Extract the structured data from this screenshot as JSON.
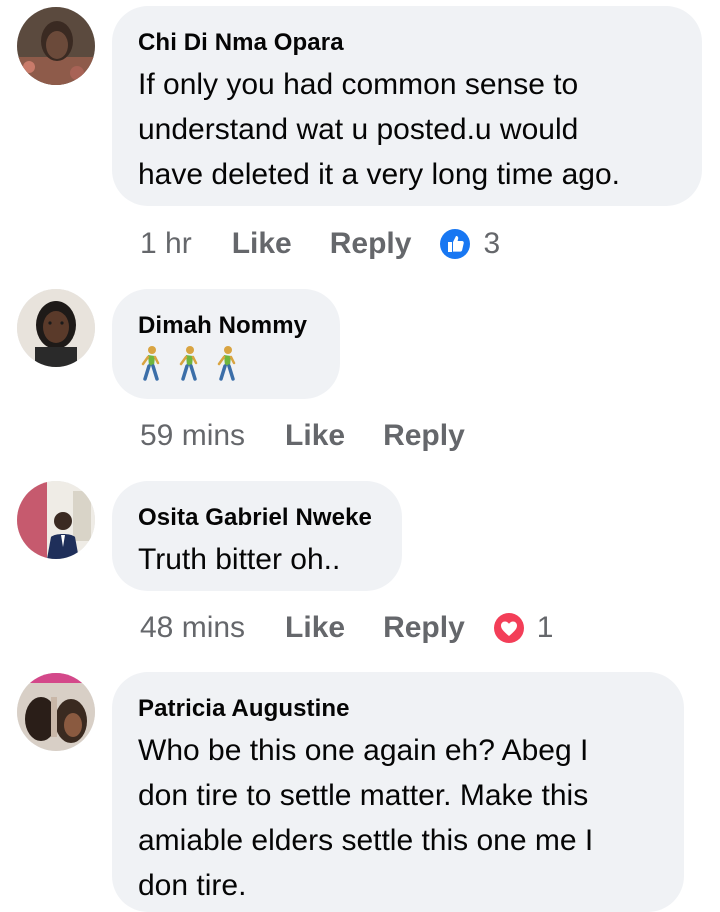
{
  "comments": [
    {
      "author": "Chi Di Nma Opara",
      "lines": [
        "If only you had common sense to",
        "understand wat u posted.u would",
        "have deleted it a very long time ago."
      ],
      "time": "1 hr",
      "like_label": "Like",
      "reply_label": "Reply",
      "reaction": "like",
      "reaction_count": "3"
    },
    {
      "author": "Dimah Nommy",
      "emoji": [
        "🚶",
        "🚶",
        "🚶"
      ],
      "time": "59 mins",
      "like_label": "Like",
      "reply_label": "Reply"
    },
    {
      "author": "Osita Gabriel Nweke",
      "lines": [
        "Truth bitter oh.."
      ],
      "time": "48 mins",
      "like_label": "Like",
      "reply_label": "Reply",
      "reaction": "love",
      "reaction_count": "1"
    },
    {
      "author": "Patricia Augustine",
      "lines": [
        "Who be this one again eh? Abeg I",
        "don tire to settle matter. Make this",
        "amiable elders settle this one me I",
        "don tire."
      ]
    }
  ],
  "colors": {
    "bubble": "#f0f2f5",
    "meta_text": "#65676b",
    "like_blue": "#1877f2",
    "love_red": "#f33e58"
  }
}
